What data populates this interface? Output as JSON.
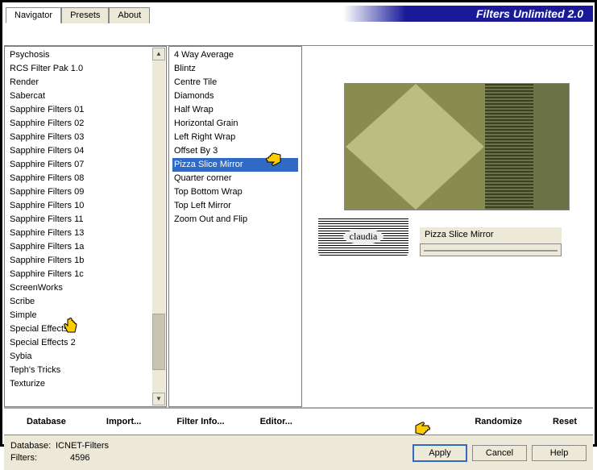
{
  "app_title": "Filters Unlimited 2.0",
  "tabs": [
    {
      "label": "Navigator",
      "active": true
    },
    {
      "label": "Presets",
      "active": false
    },
    {
      "label": "About",
      "active": false
    }
  ],
  "categories": [
    "Psychosis",
    "RCS Filter Pak 1.0",
    "Render",
    "Sabercat",
    "Sapphire Filters 01",
    "Sapphire Filters 02",
    "Sapphire Filters 03",
    "Sapphire Filters 04",
    "Sapphire Filters 07",
    "Sapphire Filters 08",
    "Sapphire Filters 09",
    "Sapphire Filters 10",
    "Sapphire Filters 11",
    "Sapphire Filters 13",
    "Sapphire Filters 1a",
    "Sapphire Filters 1b",
    "Sapphire Filters 1c",
    "ScreenWorks",
    "Scribe",
    "Simple",
    "Special Effects 1",
    "Special Effects 2",
    "Sybia",
    "Teph's Tricks",
    "Texturize"
  ],
  "category_selected_index": 19,
  "filters": [
    "4 Way Average",
    "Blintz",
    "Centre Tile",
    "Diamonds",
    "Half Wrap",
    "Horizontal Grain",
    "Left Right Wrap",
    "Offset By 3",
    "Pizza Slice Mirror",
    "Quarter corner",
    "Top Bottom Wrap",
    "Top Left Mirror",
    "Zoom Out and Flip"
  ],
  "filter_selected_index": 8,
  "param_name": "Pizza Slice Mirror",
  "watermark_text": "claudia",
  "buttons": {
    "database": "Database",
    "import": "Import...",
    "filter_info": "Filter Info...",
    "editor": "Editor...",
    "randomize": "Randomize",
    "reset": "Reset",
    "apply": "Apply",
    "cancel": "Cancel",
    "help": "Help"
  },
  "footer": {
    "db_label": "Database:",
    "db_value": "ICNET-Filters",
    "filters_label": "Filters:",
    "filters_value": "4596"
  }
}
